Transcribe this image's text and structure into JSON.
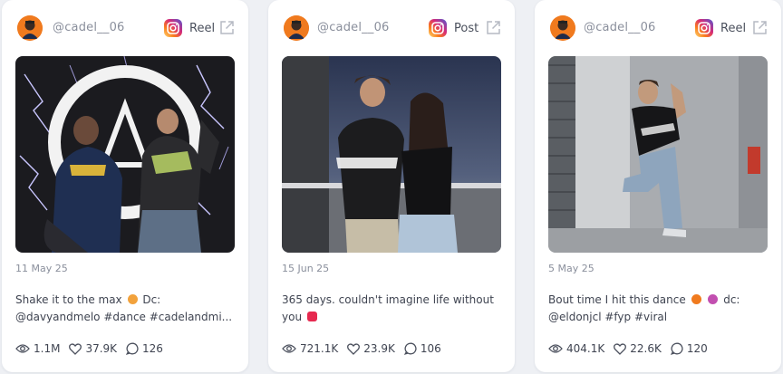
{
  "cards": [
    {
      "handle": "@cadel__06",
      "type": "Reel",
      "date": "11 May 25",
      "caption_line1": "Shake it to the max",
      "caption_line1_after": "Dc:",
      "caption_line2": "@davyandmelo #dance #cadelandmi...",
      "views": "1.1M",
      "likes": "37.9K",
      "comments": "126"
    },
    {
      "handle": "@cadel__06",
      "type": "Post",
      "date": "15 Jun 25",
      "caption_line1": "365 days. couldn't imagine life without",
      "caption_line1_after": "",
      "caption_line2": "you",
      "views": "721.1K",
      "likes": "23.9K",
      "comments": "106"
    },
    {
      "handle": "@cadel__06",
      "type": "Reel",
      "date": "5 May 25",
      "caption_line1": "Bout time I hit this dance",
      "caption_line1_after": "dc:",
      "caption_line2": "@eldonjcl #fyp #viral",
      "views": "404.1K",
      "likes": "22.6K",
      "comments": "120"
    }
  ],
  "colors": {
    "background": "#eef0f4",
    "card": "#ffffff",
    "muted_text": "#8a8f9c",
    "instagram_gradient": [
      "#feda75",
      "#fa7e1e",
      "#d62976",
      "#962fbf",
      "#4f5bd5"
    ],
    "heart_emoji": "#e6294f"
  },
  "icons": [
    "avatar",
    "instagram-icon",
    "external-link-icon",
    "eye-icon",
    "heart-icon",
    "comment-icon"
  ]
}
